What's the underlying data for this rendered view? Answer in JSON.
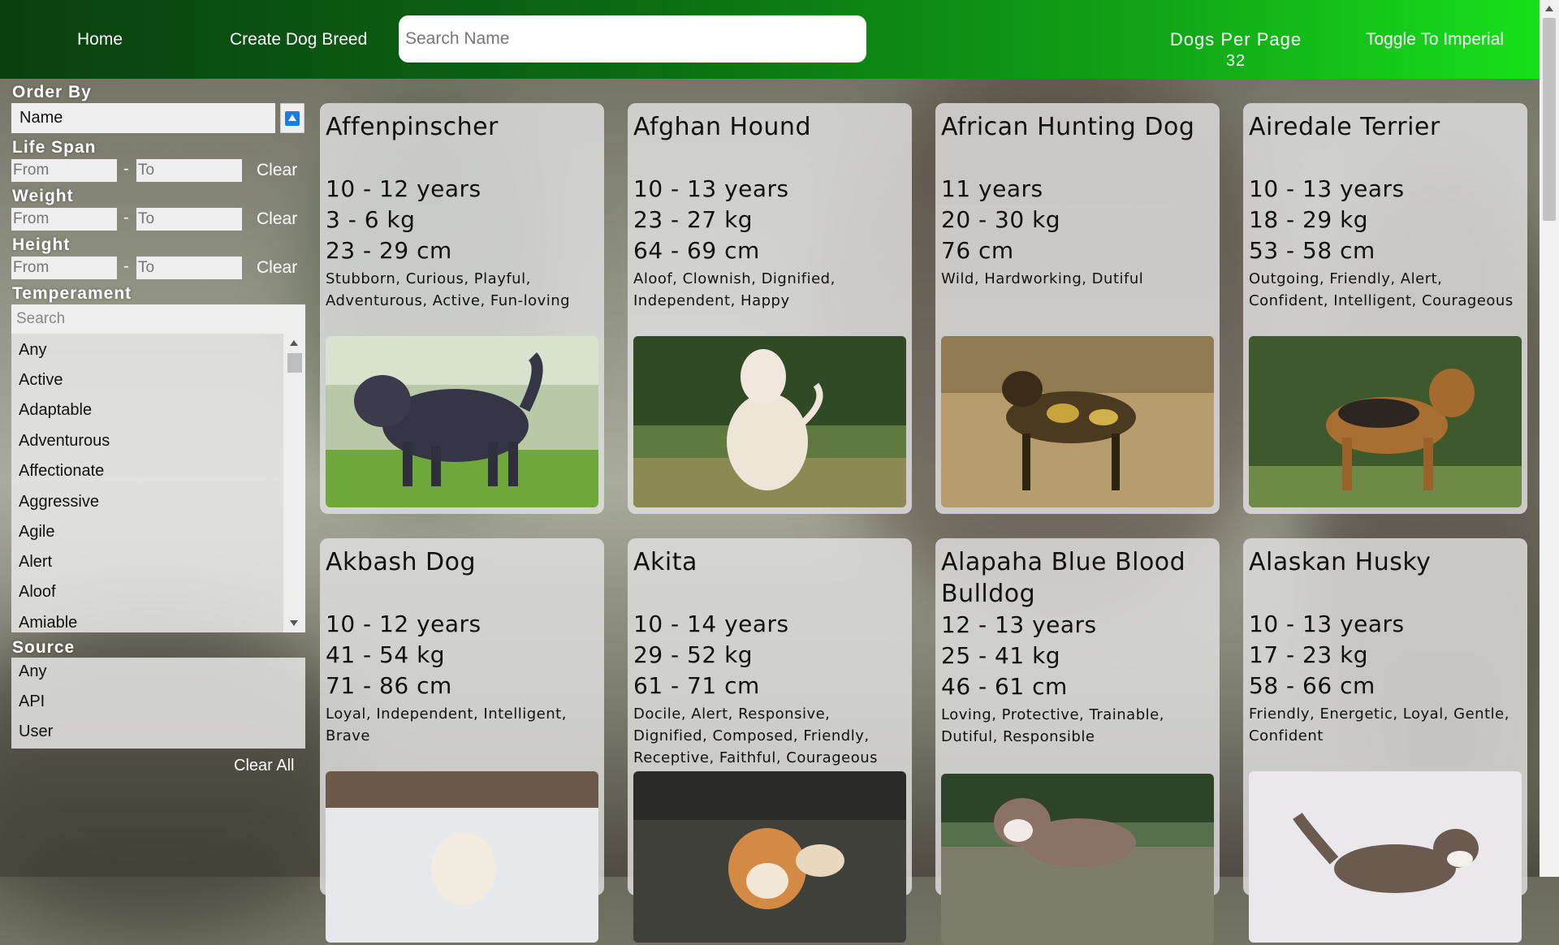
{
  "nav": {
    "home": "Home",
    "create": "Create Dog Breed",
    "search_placeholder": "Search Name",
    "per_page_label": "Dogs Per Page",
    "per_page_value": "32",
    "toggle": "Toggle To Imperial"
  },
  "sidebar": {
    "order_by_label": "Order By",
    "order_by_value": "Name",
    "life_span_label": "Life Span",
    "weight_label": "Weight",
    "height_label": "Height",
    "from_placeholder": "From",
    "to_placeholder": "To",
    "dash": "-",
    "clear": "Clear",
    "temperament_label": "Temperament",
    "temperament_search_placeholder": "Search",
    "temperaments": [
      "Any",
      "Active",
      "Adaptable",
      "Adventurous",
      "Affectionate",
      "Aggressive",
      "Agile",
      "Alert",
      "Aloof",
      "Amiable"
    ],
    "source_label": "Source",
    "sources": [
      "Any",
      "API",
      "User"
    ],
    "clear_all": "Clear All"
  },
  "dogs": [
    {
      "name": "Affenpinscher",
      "life": "10 - 12 years",
      "weight": "3 - 6 kg",
      "height": "23 - 29 cm",
      "temperament": "Stubborn, Curious, Playful, Adventurous, Active, Fun-loving"
    },
    {
      "name": "Afghan Hound",
      "life": "10 - 13 years",
      "weight": "23 - 27 kg",
      "height": "64 - 69 cm",
      "temperament": "Aloof, Clownish, Dignified, Independent, Happy"
    },
    {
      "name": "African Hunting Dog",
      "life": "11 years",
      "weight": "20 - 30 kg",
      "height": "76 cm",
      "temperament": "Wild, Hardworking, Dutiful"
    },
    {
      "name": "Airedale Terrier",
      "life": "10 - 13 years",
      "weight": "18 - 29 kg",
      "height": "53 - 58 cm",
      "temperament": "Outgoing, Friendly, Alert, Confident, Intelligent, Courageous"
    },
    {
      "name": "Akbash Dog",
      "life": "10 - 12 years",
      "weight": "41 - 54 kg",
      "height": "71 - 86 cm",
      "temperament": "Loyal, Independent, Intelligent, Brave"
    },
    {
      "name": "Akita",
      "life": "10 - 14 years",
      "weight": "29 - 52 kg",
      "height": "61 - 71 cm",
      "temperament": "Docile, Alert, Responsive, Dignified, Composed, Friendly, Receptive, Faithful, Courageous"
    },
    {
      "name": "Alapaha Blue Blood Bulldog",
      "life": "12 - 13 years",
      "weight": "25 - 41 kg",
      "height": "46 - 61 cm",
      "temperament": "Loving, Protective, Trainable, Dutiful, Responsible"
    },
    {
      "name": "Alaskan Husky",
      "life": "10 - 13 years",
      "weight": "17 - 23 kg",
      "height": "58 - 66 cm",
      "temperament": "Friendly, Energetic, Loyal, Gentle, Confident"
    }
  ]
}
